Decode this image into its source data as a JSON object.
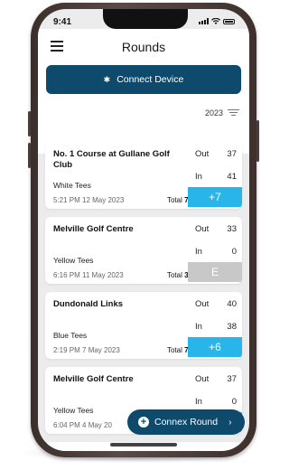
{
  "status": {
    "time": "9:41"
  },
  "header": {
    "title": "Rounds"
  },
  "connect_button_label": "Connect Device",
  "filter": {
    "year": "2023"
  },
  "rounds": [
    {
      "course": "No. 1 Course at Gullane Golf Club",
      "tees": "White Tees",
      "datetime": "5:21 PM 12 May 2023",
      "total_label": "Total",
      "total": "78",
      "out_label": "Out",
      "out": "37",
      "in_label": "In",
      "in": "41",
      "score": "+7",
      "score_style": "blue"
    },
    {
      "course": "Melville Golf Centre",
      "tees": "Yellow Tees",
      "datetime": "6:16 PM 11 May 2023",
      "total_label": "Total",
      "total": "33",
      "out_label": "Out",
      "out": "33",
      "in_label": "In",
      "in": "0",
      "score": "E",
      "score_style": "grey"
    },
    {
      "course": "Dundonald Links",
      "tees": "Blue Tees",
      "datetime": "2:19 PM 7 May 2023",
      "total_label": "Total",
      "total": "78",
      "out_label": "Out",
      "out": "40",
      "in_label": "In",
      "in": "38",
      "score": "+6",
      "score_style": "blue"
    },
    {
      "course": "Melville Golf Centre",
      "tees": "Yellow Tees",
      "datetime": "6:04 PM 4 May 20",
      "total_label": "",
      "total": "",
      "out_label": "Out",
      "out": "37",
      "in_label": "In",
      "in": "0",
      "score": "",
      "score_style": "blue"
    }
  ],
  "fab": {
    "label": "Connex Round"
  },
  "colors": {
    "primary": "#0e4a6c",
    "score_blue": "#27b5ea",
    "score_grey": "#c8c8c8"
  }
}
